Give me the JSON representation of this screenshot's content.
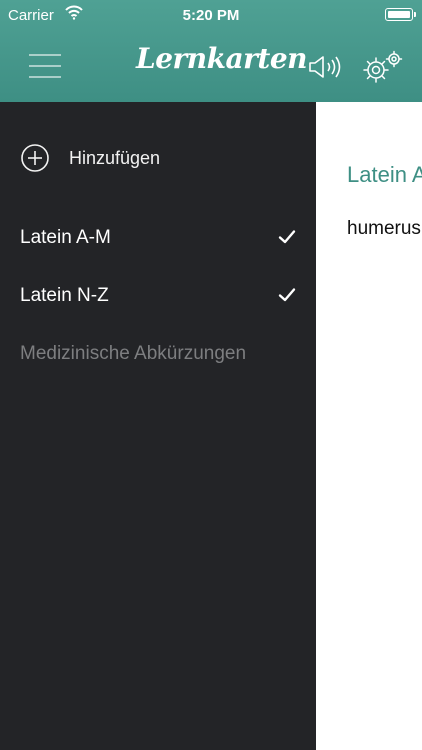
{
  "status_bar": {
    "carrier": "Carrier",
    "time": "5:20 PM"
  },
  "header": {
    "title": "Lernkarten",
    "icons": [
      "menu-icon",
      "speaker-icon",
      "gear-icon"
    ]
  },
  "sidebar": {
    "add_label": "Hinzufügen",
    "items": [
      {
        "label": "Latein A-M",
        "checked": true
      },
      {
        "label": "Latein N-Z",
        "checked": true
      },
      {
        "label": "Medizinische Abkürzungen",
        "checked": false
      }
    ]
  },
  "main": {
    "deck_title": "Latein A",
    "card_word": "humerus"
  },
  "colors": {
    "accent": "#3e8f84",
    "sidebar_bg": "#232427",
    "inactive_text": "#7d7e80"
  }
}
